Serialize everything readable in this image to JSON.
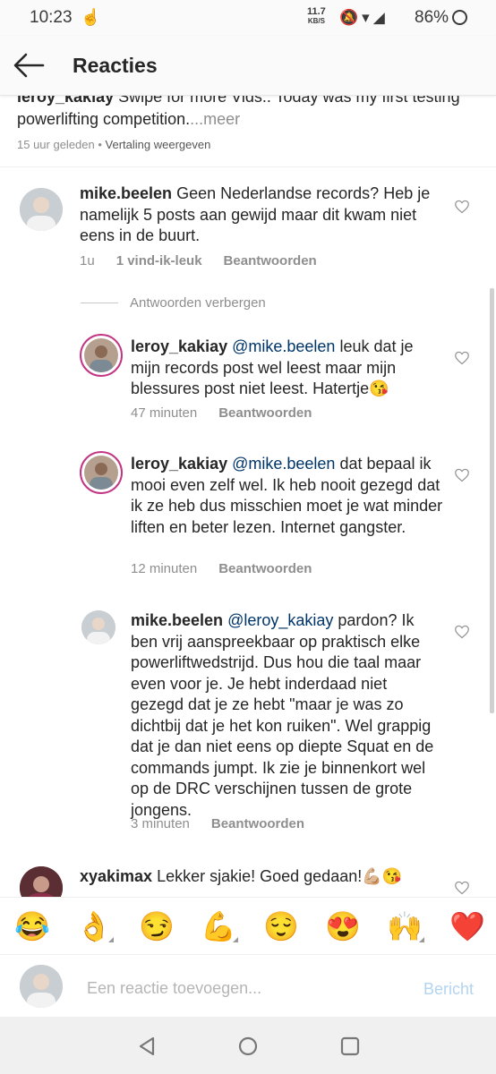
{
  "status": {
    "time": "10:23",
    "net_speed": "11.7",
    "net_unit": "KB/S",
    "battery": "86%"
  },
  "header": {
    "title": "Reacties"
  },
  "caption": {
    "user": "leroy_kakiay",
    "text": " Swipe for more Vids.. Today was my first testing powerlifting competition.",
    "more": "...meer",
    "time": "15 uur geleden",
    "sep": " • ",
    "translate": "Vertaling weergeven"
  },
  "comments": [
    {
      "user": "mike.beelen",
      "mention": "",
      "text": " Geen Nederlandse records? Heb je namelijk 5 posts aan gewijd maar dit kwam niet eens in de buurt.",
      "time": "1u",
      "likes": "1 vind-ik-leuk",
      "reply": "Beantwoorden"
    }
  ],
  "replies_toggle": "Antwoorden verbergen",
  "replies": [
    {
      "user": "leroy_kakiay",
      "mention": "@mike.beelen",
      "text": " leuk dat je mijn records post wel leest maar mijn blessures post niet leest. Hatertje😘",
      "time": "47 minuten",
      "reply": "Beantwoorden"
    },
    {
      "user": "leroy_kakiay",
      "mention": "@mike.beelen",
      "text": " dat bepaal ik mooi even zelf wel. Ik heb nooit gezegd dat ik ze heb dus misschien moet je wat minder liften en beter lezen. Internet gangster.",
      "time": "12 minuten",
      "reply": "Beantwoorden"
    },
    {
      "user": "mike.beelen",
      "mention": "@leroy_kakiay",
      "text": " pardon? Ik ben vrij aanspreekbaar op praktisch elke powerliftwedstrijd. Dus hou die taal maar even voor je. Je hebt inderdaad niet gezegd dat je ze hebt \"maar je was zo dichtbij dat je het kon ruiken\". Wel grappig dat je dan niet eens op diepte Squat en de commands jumpt. Ik zie je binnenkort wel op de DRC verschijnen tussen de grote jongens.",
      "time": "3 minuten",
      "reply": "Beantwoorden"
    }
  ],
  "last_comment": {
    "user": "xyakimax",
    "text": " Lekker sjakie! Goed gedaan!💪🏼😘"
  },
  "emojis": [
    "😂",
    "👌",
    "😏",
    "💪",
    "😌",
    "😍",
    "🙌",
    "❤️"
  ],
  "composer": {
    "placeholder": "Een reactie toevoegen...",
    "post_label": "Bericht"
  },
  "colors": {
    "link": "#003569",
    "muted": "#8e8e8e",
    "post_disabled": "#b3d4f0",
    "story_ring": "#c13584"
  }
}
